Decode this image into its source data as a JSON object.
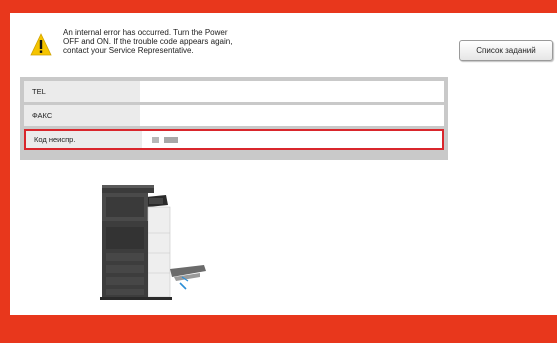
{
  "error": {
    "message_lines": [
      "An internal error has occurred. Turn the Power",
      "OFF and ON.  If the trouble code appears again,",
      "contact your Service Representative."
    ]
  },
  "toolbar": {
    "job_list_label": "Список заданий"
  },
  "info_rows": [
    {
      "label": "TEL",
      "value": ""
    },
    {
      "label": "ФАКС",
      "value": ""
    },
    {
      "label": "Код неиспр.",
      "value": ""
    }
  ],
  "icons": {
    "warning": "warning-icon",
    "printer": "printer-illustration"
  },
  "colors": {
    "frame": "#e8371c",
    "highlight": "#d9262c",
    "warning": "#f5c400"
  }
}
